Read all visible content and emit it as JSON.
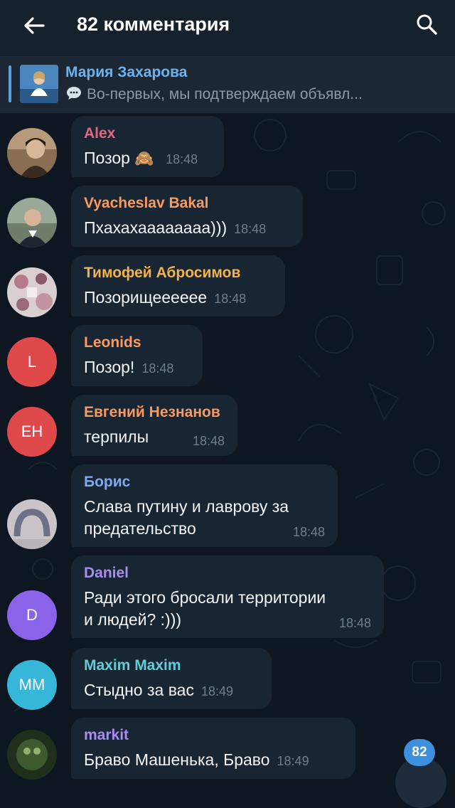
{
  "header": {
    "title": "82 комментария",
    "back_icon": "arrow-left-icon",
    "search_icon": "search-icon"
  },
  "pinned": {
    "name": "Мария Захарова",
    "text": "Во-первых, мы подтверждаем объявл..."
  },
  "messages": [
    {
      "sender": "Alex",
      "text": "Позор",
      "emoji": "🙈",
      "time": "18:48",
      "name_color": "#e56582"
    },
    {
      "sender": "Vyacheslav Bakal",
      "text": "Пхахахаааааааа)))",
      "time": "18:48",
      "name_color": "#fa9a5e"
    },
    {
      "sender": "Тимофей Абросимов",
      "text": "Позорищееееее",
      "time": "18:48",
      "name_color": "#f5b247"
    },
    {
      "sender": "Leonids",
      "text": "Позор!",
      "time": "18:48",
      "avatar_initials": "L",
      "name_color": "#fa9a5e"
    },
    {
      "sender": "Евгений Незнанов",
      "text": "терпилы",
      "time": "18:48",
      "avatar_initials": "ЕН",
      "name_color": "#fa9a5e"
    },
    {
      "sender": "Борис",
      "text_line1": "Слава путину и лаврову за",
      "text_line2": "предательство",
      "time": "18:48",
      "name_color": "#7fa8f1"
    },
    {
      "sender": "Daniel",
      "text_line1": "Ради этого бросали территории",
      "text_line2": "и людей? :)))",
      "time": "18:48",
      "avatar_initials": "D",
      "name_color": "#a98cf0"
    },
    {
      "sender": "Maxim Maxim",
      "text": "Стыдно за вас",
      "time": "18:49",
      "avatar_initials": "MM",
      "name_color": "#5ecfd9"
    },
    {
      "sender": "markit",
      "text": "Браво Машенька, Браво",
      "time": "18:49",
      "name_color": "#a98cf0"
    }
  ],
  "unread_count": "82",
  "colors": {
    "header_bg": "#17212b",
    "chat_bg": "#0e1621",
    "bubble_bg": "#182533",
    "accent": "#6ab3f3"
  }
}
